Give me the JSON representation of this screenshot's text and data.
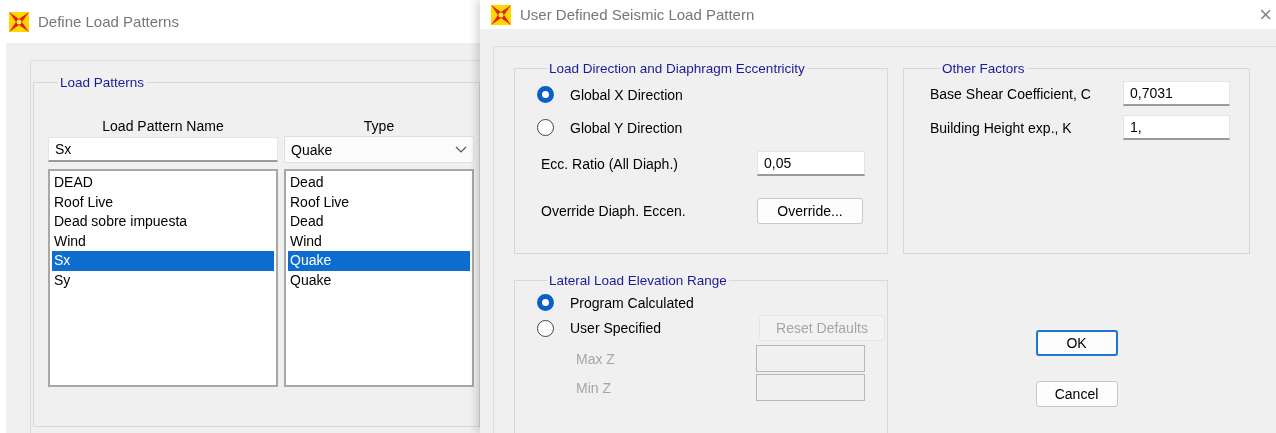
{
  "define_load_patterns": {
    "title": "Define Load Patterns",
    "group_title": "Load Patterns",
    "columns": [
      "Load Pattern Name",
      "Type"
    ],
    "name_field": {
      "value": "Sx"
    },
    "type_dropdown": {
      "value": "Quake"
    },
    "rows": [
      {
        "name": "DEAD",
        "type": "Dead",
        "selected": false
      },
      {
        "name": "Roof Live",
        "type": "Roof Live",
        "selected": false
      },
      {
        "name": "Dead sobre impuesta",
        "type": "Dead",
        "selected": false
      },
      {
        "name": "Wind",
        "type": "Wind",
        "selected": false
      },
      {
        "name": "Sx",
        "type": "Quake",
        "selected": true
      },
      {
        "name": "Sy",
        "type": "Quake",
        "selected": false
      }
    ]
  },
  "seismic_dialog": {
    "title": "User Defined Seismic Load Pattern",
    "close": "×",
    "direction_group": {
      "title": "Load Direction and Diaphragm Eccentricity",
      "options": [
        {
          "label": "Global  X  Direction",
          "selected": true
        },
        {
          "label": "Global  Y  Direction",
          "selected": false
        }
      ],
      "ecc_label": "Ecc. Ratio (All Diaph.)",
      "ecc_value": "0,05",
      "override_label": "Override Diaph. Eccen.",
      "override_button": "Override..."
    },
    "other_factors": {
      "title": "Other Factors",
      "fields": [
        {
          "label": "Base Shear Coefficient, C",
          "value": "0,7031"
        },
        {
          "label": "Building Height exp., K",
          "value": "1,"
        }
      ]
    },
    "elevation_group": {
      "title": "Lateral Load Elevation Range",
      "options": [
        {
          "label": "Program Calculated",
          "selected": true
        },
        {
          "label": "User Specified",
          "selected": false
        }
      ],
      "reset_button": {
        "label": "Reset Defaults",
        "disabled": true
      },
      "fields": [
        {
          "label": "Max Z",
          "disabled": true
        },
        {
          "label": "Min Z",
          "disabled": true
        }
      ]
    },
    "buttons": [
      {
        "label": "OK",
        "default": true
      },
      {
        "label": "Cancel",
        "default": false
      }
    ]
  }
}
